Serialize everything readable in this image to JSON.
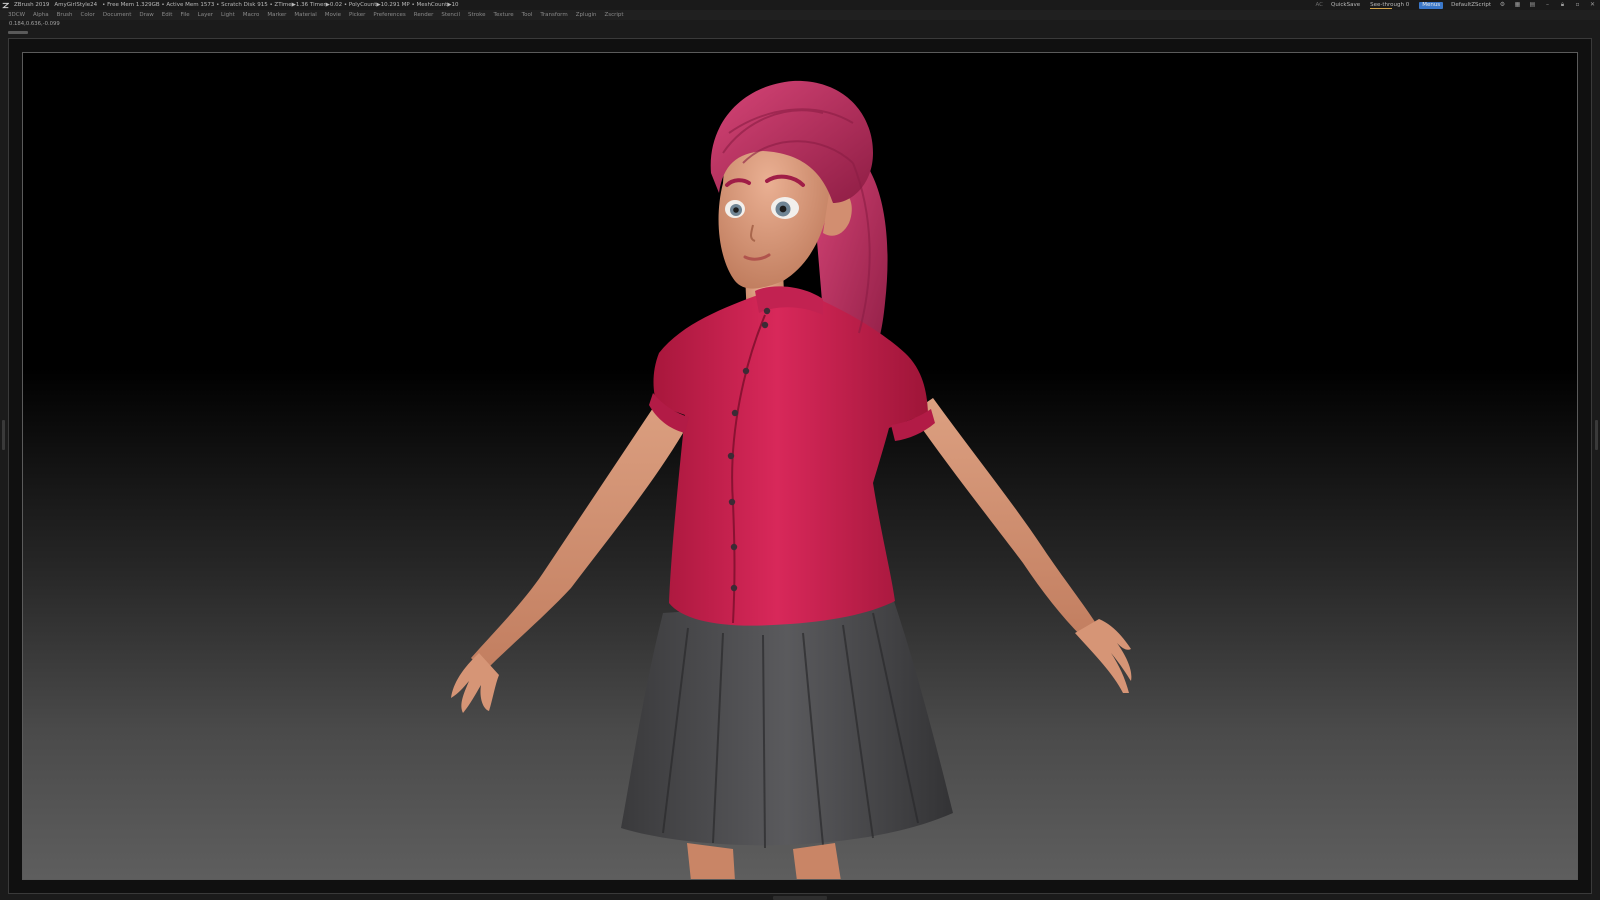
{
  "titlebar": {
    "app": "ZBrush 2019",
    "document": "AmyGirlStyle24",
    "stats": "• Free Mem 1.329GB • Active Mem 1573 • Scratch Disk 915 • ZTime▶1.36 Timer▶0.02 • PolyCount▶10.291 MP • MeshCount▶10",
    "ac": "AC",
    "quicksave": "QuickSave",
    "see_through": "See-through  0",
    "menus_chip": "Menus",
    "default_script": "DefaultZScript"
  },
  "menubar": {
    "items": [
      "3DCW",
      "Alpha",
      "Brush",
      "Color",
      "Document",
      "Draw",
      "Edit",
      "File",
      "Layer",
      "Light",
      "Macro",
      "Marker",
      "Material",
      "Movie",
      "Picker",
      "Preferences",
      "Render",
      "Stencil",
      "Stroke",
      "Texture",
      "Tool",
      "Transform",
      "Zplugin",
      "Zscript"
    ]
  },
  "status": {
    "coords": "0.184,0.636,-0.099"
  },
  "colors": {
    "shirt": "#c81f4a",
    "hair": "#c02a5a",
    "skin": "#dc9a7a",
    "skirt": "#4a4a4c",
    "accent": "#3a77c9"
  },
  "icons": [
    "zbrush-logo-icon",
    "settings-icon",
    "layout-icon",
    "lock-icon",
    "minimize-icon",
    "maximize-icon",
    "close-icon"
  ]
}
